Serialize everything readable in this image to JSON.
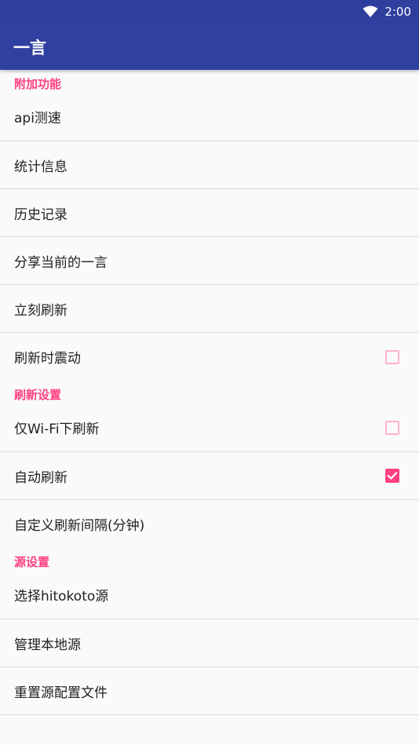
{
  "status_bar": {
    "time": "2:00",
    "wifi_icon": "wifi-icon"
  },
  "app_bar": {
    "title": "一言"
  },
  "colors": {
    "primary": "#3040a1",
    "primary_dark": "#2f3f9e",
    "accent": "#ff4081"
  },
  "sections": [
    {
      "header": "附加功能",
      "items": [
        {
          "label": "api测速"
        },
        {
          "label": "统计信息"
        },
        {
          "label": "历史记录"
        },
        {
          "label": "分享当前的一言"
        },
        {
          "label": "立刻刷新"
        },
        {
          "label": "刷新时震动",
          "checkbox": false
        }
      ]
    },
    {
      "header": "刷新设置",
      "items": [
        {
          "label": "仅Wi-Fi下刷新",
          "checkbox": false
        },
        {
          "label": "自动刷新",
          "checkbox": true
        },
        {
          "label": "自定义刷新间隔(分钟)"
        }
      ]
    },
    {
      "header": "源设置",
      "items": [
        {
          "label": "选择hitokoto源"
        },
        {
          "label": "管理本地源"
        },
        {
          "label": "重置源配置文件"
        }
      ]
    }
  ]
}
